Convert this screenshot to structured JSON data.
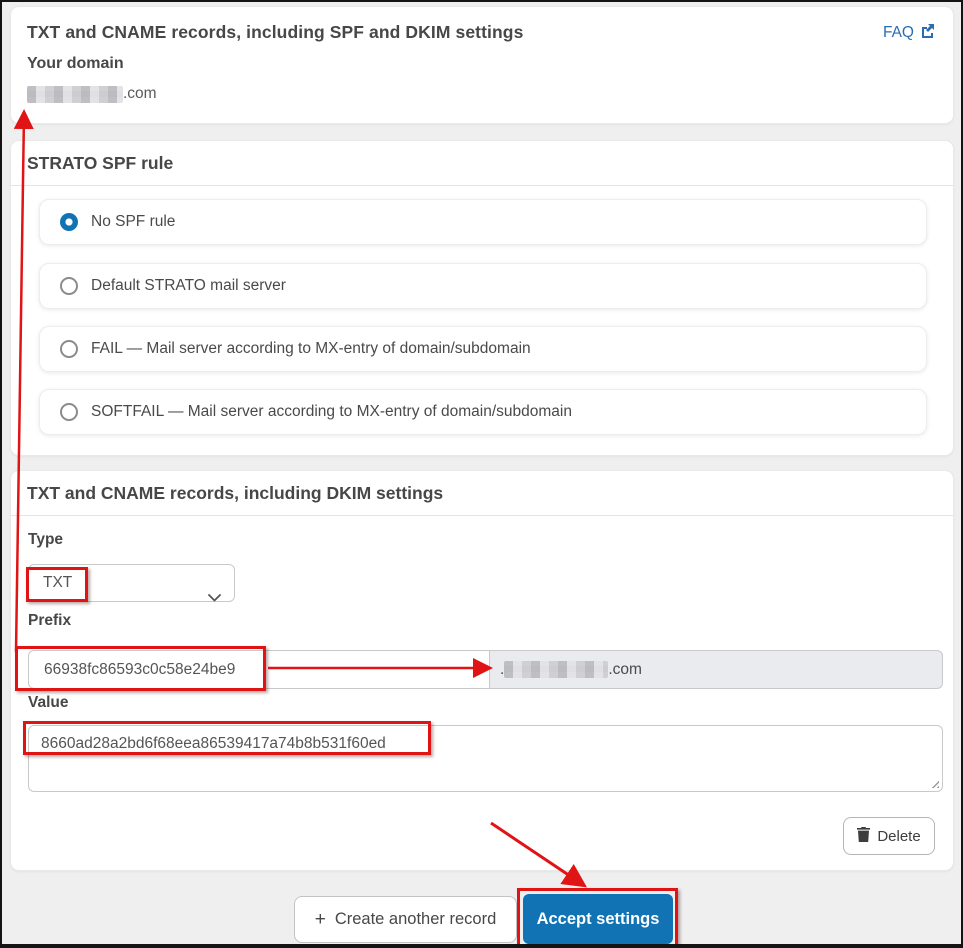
{
  "page": {
    "title": "TXT and CNAME records, including SPF and DKIM settings",
    "faq_label": "FAQ",
    "your_domain_label": "Your domain",
    "domain_tld": ".com",
    "domain_redacted": true
  },
  "spf_section": {
    "heading": "STRATO SPF rule",
    "options": [
      {
        "label": "No SPF rule",
        "selected": true
      },
      {
        "label": "Default STRATO mail server",
        "selected": false
      },
      {
        "label": "FAIL — Mail server according to MX-entry of domain/subdomain",
        "selected": false
      },
      {
        "label": "SOFTFAIL — Mail server according to MX-entry of domain/subdomain",
        "selected": false
      }
    ]
  },
  "dkim_section": {
    "heading": "TXT and CNAME records, including DKIM settings",
    "type_label": "Type",
    "type_value": "TXT",
    "prefix_label": "Prefix",
    "prefix_value": "66938fc86593c0c58e24be9",
    "prefix_suffix_dot": ".",
    "prefix_suffix_tld": ".com",
    "value_label": "Value",
    "value_text": "8660ad28a2bd6f68eea86539417a74b8b531f60ed",
    "delete_label": "Delete"
  },
  "footer": {
    "create_plus": "+",
    "create_label": "Create another record",
    "accept_label": "Accept settings"
  },
  "colors": {
    "accent_blue": "#1173b4",
    "link_blue": "#2a6db0",
    "annotation_red": "#e01414",
    "input_suffix_bg": "#e9ebee"
  }
}
